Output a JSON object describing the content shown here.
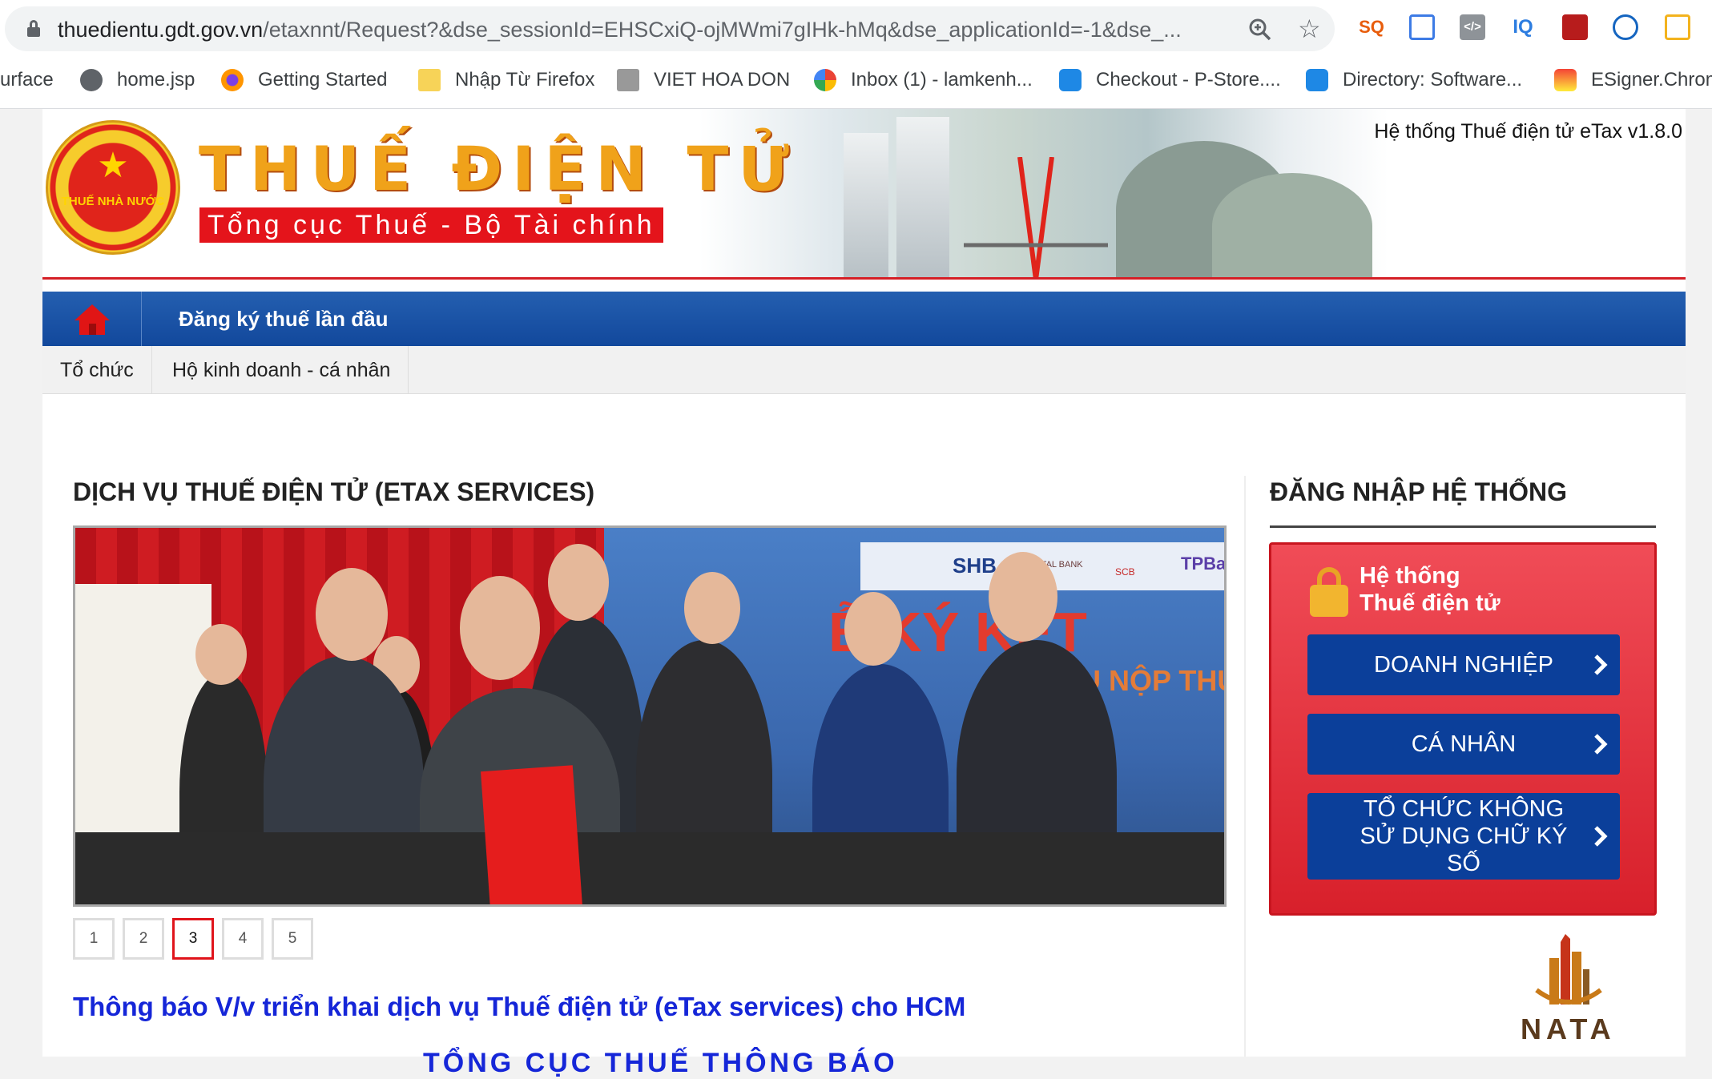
{
  "browser": {
    "url_host": "thuedientu.gdt.gov.vn",
    "url_path": "/etaxnnt/Request?&dse_sessionId=EHSCxiQ-ojMWmi7gIHk-hMq&dse_applicationId=-1&dse_...",
    "extensions": [
      "SQ",
      "",
      "</>",
      "IQ",
      "",
      "",
      ""
    ],
    "bookmarks": [
      {
        "label": "urface",
        "color": ""
      },
      {
        "label": "home.jsp",
        "color": "#5f6368"
      },
      {
        "label": "Getting Started",
        "color": "#e66000"
      },
      {
        "label": "Nhập Từ Firefox",
        "color": "#f7d358"
      },
      {
        "label": "VIET HOA DON",
        "color": "#888888"
      },
      {
        "label": "Inbox (1) - lamkenh...",
        "color": "#4285f4"
      },
      {
        "label": "Checkout - P-Store....",
        "color": "#1e88e5"
      },
      {
        "label": "Directory: Software...",
        "color": "#1e88e5"
      },
      {
        "label": "ESigner.Chrom",
        "color": "#d32f2f"
      }
    ]
  },
  "header": {
    "emblem_text": "THUẾ NHÀ NƯỚC",
    "title": "THUẾ ĐIỆN TỬ",
    "subtitle": "Tổng cục Thuế - Bộ Tài chính",
    "version": "Hệ thống Thuế điện tử eTax v1.8.0"
  },
  "nav": {
    "main_link": "Đăng ký thuế lần đầu",
    "tabs": [
      "Tổ chức",
      "Hộ kinh doanh - cá nhân"
    ]
  },
  "services": {
    "title": "DỊCH VỤ THUẾ ĐIỆN TỬ (ETAX SERVICES)",
    "photo_banner_line1": "Ễ KÝ KẾT",
    "photo_banner_line2": "VỤ NỘP THUẾ\nÀNG THƯƠN",
    "photo_logos": [
      "SHB",
      "CAPITAL BANK",
      "SCB",
      "TPBank"
    ],
    "pages": [
      "1",
      "2",
      "3",
      "4",
      "5"
    ],
    "active_page": "3",
    "news_link": "Thông báo V/v triển khai dịch vụ Thuế điện tử (eTax services) cho HCM",
    "news_sub": "TỔNG CỤC THUẾ THÔNG BÁO"
  },
  "login": {
    "title": "ĐĂNG NHẬP HỆ THỐNG",
    "box_heading_1": "Hệ thống",
    "box_heading_2": "Thuế điện tử",
    "buttons": [
      "DOANH NGHIỆP",
      "CÁ NHÂN",
      "TỔ CHỨC KHÔNG SỬ DỤNG CHỮ KÝ SỐ"
    ]
  },
  "sponsor": {
    "text": "NATA"
  }
}
